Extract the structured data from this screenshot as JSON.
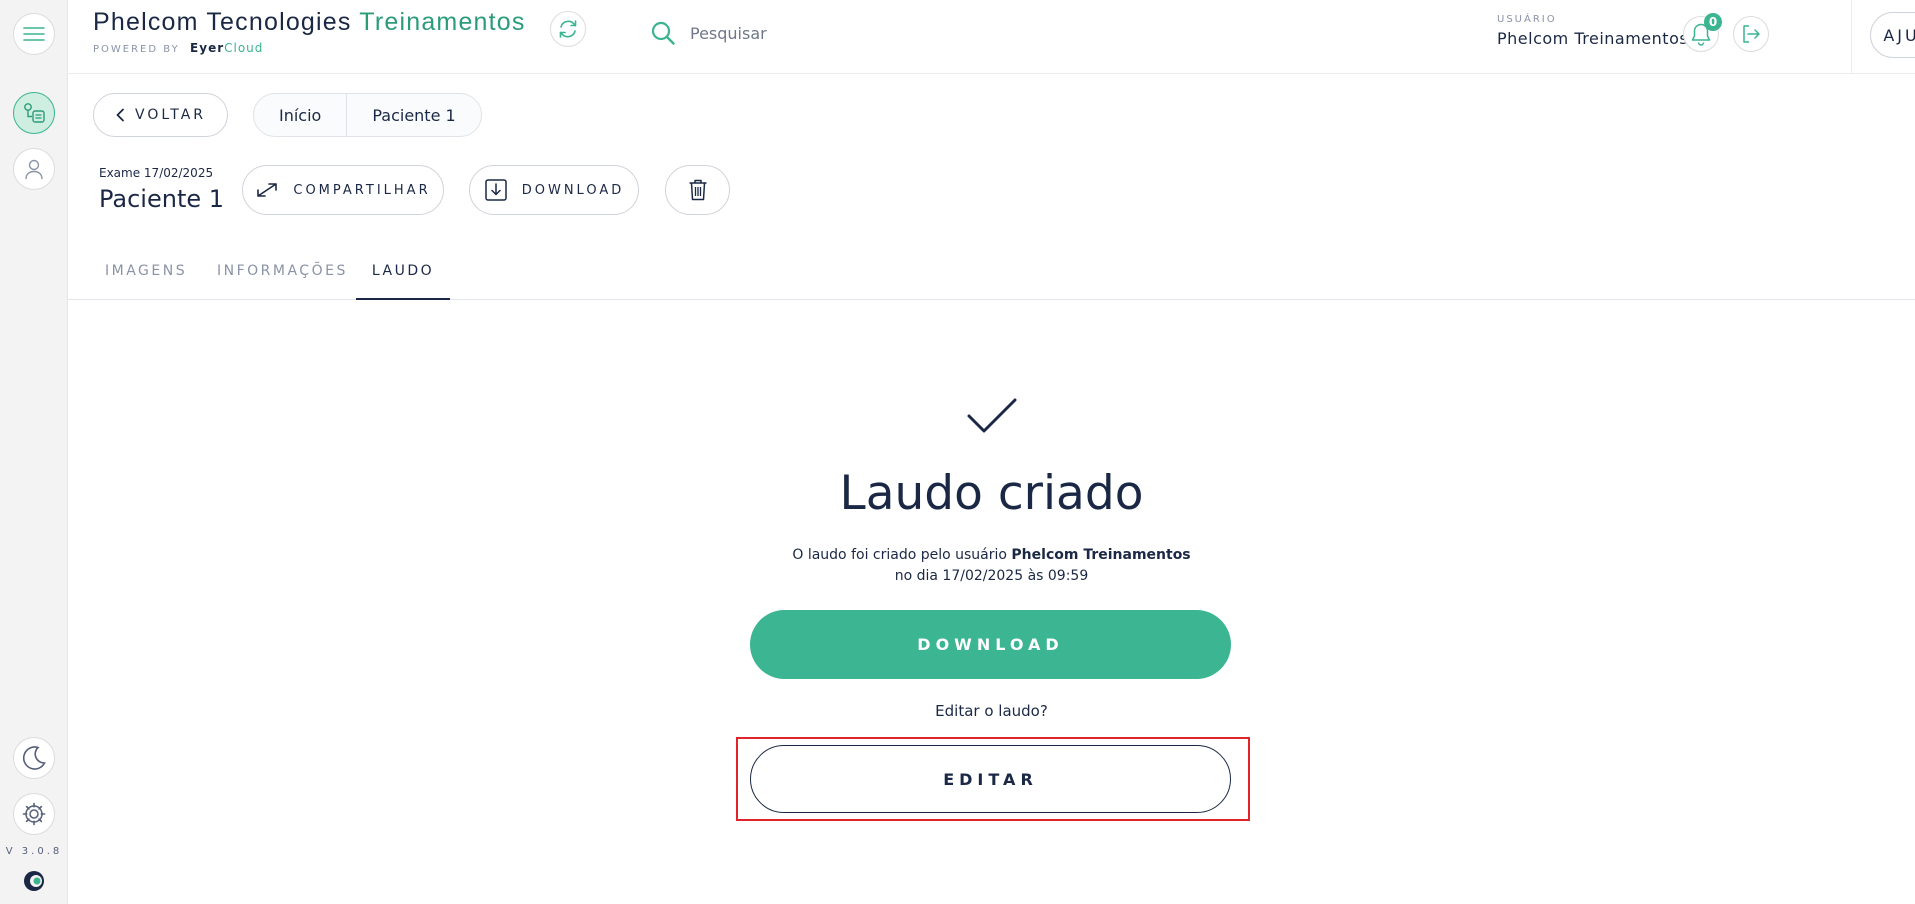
{
  "header": {
    "brand_main": "Phelcom Tecnologies",
    "brand_highlight": "Treinamentos",
    "powered_by": "POWERED BY",
    "powered_eyer": "Eyer",
    "powered_cloud": "Cloud",
    "search_placeholder": "Pesquisar",
    "user_caption": "USUÁRIO",
    "user_name": "Phelcom Treinamentos",
    "notifications_count": "0",
    "help_label": "AJUDA"
  },
  "sidebar": {
    "version": "V 3.0.8"
  },
  "nav": {
    "back_label": "VOLTAR",
    "breadcrumbs": [
      "Início",
      "Paciente 1"
    ]
  },
  "exam": {
    "date_label": "Exame 17/02/2025",
    "patient_name": "Paciente 1",
    "share_label": "COMPARTILHAR",
    "download_label": "DOWNLOAD"
  },
  "tabs": [
    {
      "label": "IMAGENS",
      "active": false
    },
    {
      "label": "INFORMAÇÕES",
      "active": false
    },
    {
      "label": "LAUDO",
      "active": true
    }
  ],
  "report": {
    "title": "Laudo criado",
    "created_by_prefix": "O laudo foi criado pelo usuário",
    "created_by_user": "Phelcom Treinamentos",
    "created_on": "no dia 17/02/2025 às 09:59",
    "download_label": "DOWNLOAD",
    "edit_question": "Editar o laudo?",
    "edit_label": "EDITAR"
  },
  "colors": {
    "accent": "#3cb592",
    "text": "#1b2845",
    "highlight_box": "#e0242c"
  }
}
